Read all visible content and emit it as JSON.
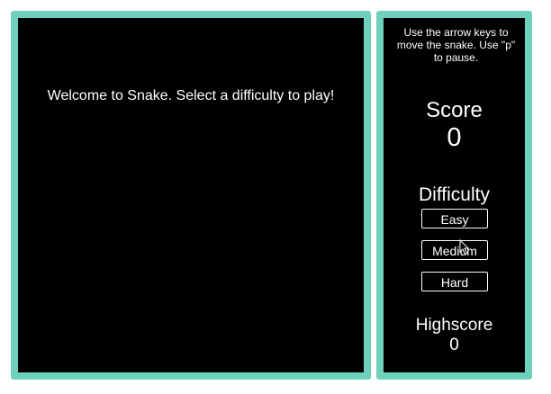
{
  "game": {
    "welcome_message": "Welcome to Snake. Select a difficulty to play!"
  },
  "sidebar": {
    "instructions": "Use the arrow keys to move the snake. Use \"p\" to pause.",
    "score_label": "Score",
    "score_value": "0",
    "difficulty_label": "Difficulty",
    "difficulty_options": [
      "Easy",
      "Medium",
      "Hard"
    ],
    "highscore_label": "Highscore",
    "highscore_value": "0"
  },
  "colors": {
    "border": "#6fd1bc",
    "background": "#000000",
    "text": "#ffffff"
  },
  "icons": {
    "cursor": "mouse-pointer-icon"
  }
}
